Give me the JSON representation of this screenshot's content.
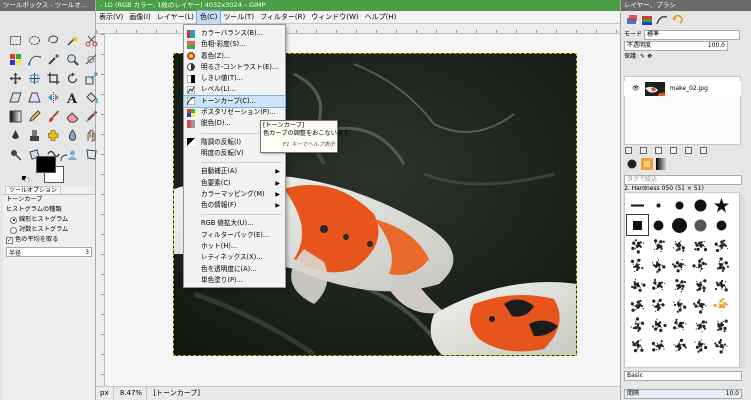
{
  "main_window": {
    "title": "- LO (RGB カラー, 1枚のレイヤー) 4032x3024 – GIMP",
    "menus": [
      "表示(V)",
      "画像(I)",
      "レイヤー(L)",
      "色(C)",
      "ツール(T)",
      "フィルター(R)",
      "ウィンドウ(W)",
      "ヘルプ(H)"
    ],
    "active_menu": "色(C)",
    "status": {
      "unit": "px",
      "zoom": "8.47%",
      "message": "[トーンカーブ]"
    }
  },
  "colors_menu": {
    "group1": [
      {
        "label": "カラーバランス(B)...",
        "icon": "color-balance-icon"
      },
      {
        "label": "色相-彩度(S)...",
        "icon": "hue-saturation-icon"
      },
      {
        "label": "着色(Z)...",
        "icon": "colorize-icon"
      },
      {
        "label": "明るさ-コントラスト(E)...",
        "icon": "brightness-contrast-icon"
      },
      {
        "label": "しきい値(T)...",
        "icon": "threshold-icon"
      },
      {
        "label": "レベル(L)...",
        "icon": "levels-icon"
      },
      {
        "label": "トーンカーブ(C)...",
        "icon": "curves-icon",
        "highlighted": true
      },
      {
        "label": "ポスタリゼーション(P)...",
        "icon": "posterize-icon"
      },
      {
        "label": "脱色(D)...",
        "icon": "desaturate-icon"
      }
    ],
    "group2": [
      {
        "label": "階調の反転(I)",
        "icon": "invert-icon"
      },
      {
        "label": "明度の反転(V)",
        "icon": ""
      }
    ],
    "group3": [
      {
        "label": "自動補正(A)",
        "submenu": true
      },
      {
        "label": "色要素(C)",
        "submenu": true
      },
      {
        "label": "カラーマッピング(M)",
        "submenu": true
      },
      {
        "label": "色の情報(F)",
        "submenu": true
      }
    ],
    "group4": [
      {
        "label": "RGB 値拡大(U)..."
      },
      {
        "label": "フィルターパック(E)..."
      },
      {
        "label": "ホット(H)..."
      },
      {
        "label": "レティネックス(X)..."
      },
      {
        "label": "色を透明度に(A)..."
      },
      {
        "label": "単色塗り(P)..."
      }
    ]
  },
  "tooltip": {
    "title": "[トーンカーブ]",
    "desc": "色カーブの調整をおこないます",
    "help": "F1 キーでヘルプ表示"
  },
  "toolbox": {
    "title": "ツールボックス - ツールオ...",
    "tools": [
      "rect-select-icon",
      "ellipse-select-icon",
      "lasso-icon",
      "fuzzy-select-icon",
      "scissors-icon",
      "color-select-icon",
      "paths-icon",
      "color-picker-icon",
      "zoom-icon",
      "measure-icon",
      "move-icon",
      "align-icon",
      "crop-icon",
      "rotate-icon",
      "scale-icon",
      "shear-icon",
      "perspective-icon",
      "flip-icon",
      "text-icon",
      "bucket-fill-icon",
      "gradient-icon",
      "pencil-icon",
      "paintbrush-icon",
      "eraser-icon",
      "airbrush-icon",
      "ink-icon",
      "clone-icon",
      "heal-icon",
      "blur-icon",
      "smudge-icon",
      "dodge-icon",
      "transform-icon",
      "warp-icon",
      "foreground-select-icon",
      "cage-icon"
    ],
    "tab_label": "ツールオプション",
    "options": {
      "title": "トーンカーブ",
      "histogram_label": "ヒストグラムの種類",
      "linear": "線形ヒストグラム",
      "log": "対数ヒストグラム",
      "average": "色の平均を取る",
      "sample": "半径",
      "sample_value": "3"
    }
  },
  "dock": {
    "title": "レイヤー、ブラシ",
    "mode_label": "モード",
    "mode_value": "標準",
    "opacity_label": "不透明度",
    "opacity_value": "100.0",
    "lock_label": "保護:",
    "layer_name": "make_02.jpg",
    "brush_filter_placeholder": "タグで絞込",
    "brush_name": "2. Hardness 050 (51 × 51)",
    "brush_preset": "Basic",
    "spacing_label": "間隔",
    "spacing_value": "10.0"
  },
  "colors": {
    "title_green": "#4a9e45",
    "menu_highlight": "#cce4f7",
    "koi_orange": "#e8551c"
  }
}
